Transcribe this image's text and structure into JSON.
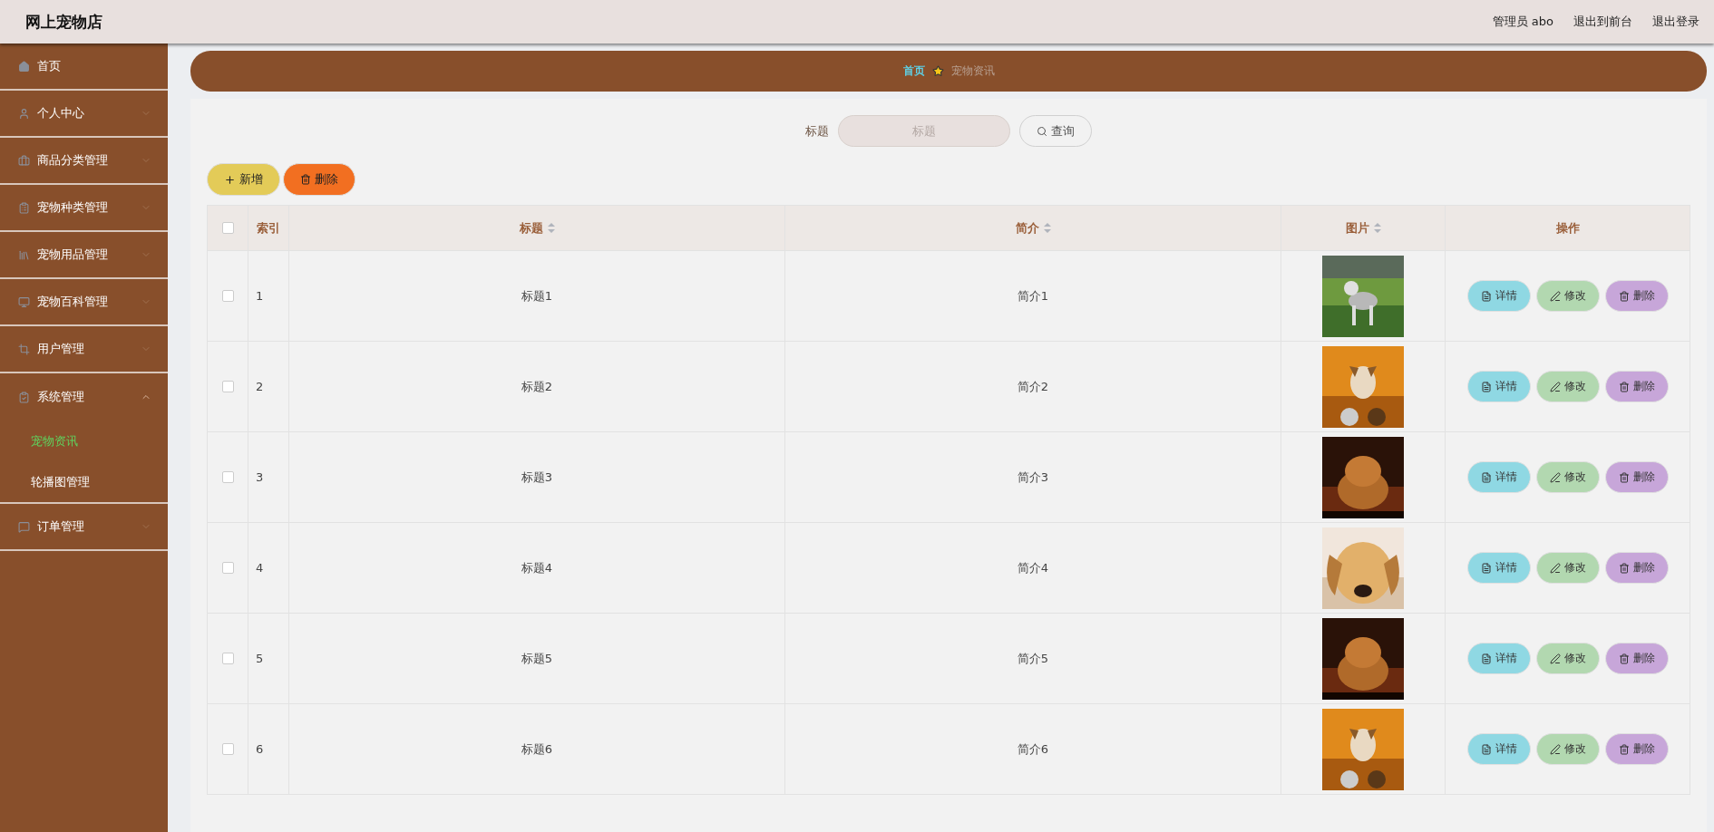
{
  "header": {
    "title": "网上宠物店",
    "links": [
      "管理员 abo",
      "退出到前台",
      "退出登录"
    ]
  },
  "sidebar": {
    "items": [
      {
        "label": "首页",
        "kind": "link"
      },
      {
        "label": "个人中心",
        "kind": "group",
        "expanded": false
      },
      {
        "label": "商品分类管理",
        "kind": "group",
        "expanded": false
      },
      {
        "label": "宠物种类管理",
        "kind": "group",
        "expanded": false
      },
      {
        "label": "宠物用品管理",
        "kind": "group",
        "expanded": false
      },
      {
        "label": "宠物百科管理",
        "kind": "group",
        "expanded": false
      },
      {
        "label": "用户管理",
        "kind": "group",
        "expanded": false
      },
      {
        "label": "系统管理",
        "kind": "group",
        "expanded": true,
        "children": [
          {
            "label": "宠物资讯",
            "selected": true
          },
          {
            "label": "轮播图管理",
            "selected": false
          }
        ]
      },
      {
        "label": "订单管理",
        "kind": "group",
        "expanded": false
      }
    ]
  },
  "breadcrumb": [
    {
      "label": "首页",
      "current": false
    },
    {
      "label": "宠物资讯",
      "current": true
    }
  ],
  "search": {
    "label": "标题",
    "placeholder": "标题",
    "button": "查询"
  },
  "toolbar": [
    {
      "label": "新增",
      "kind": "add"
    },
    {
      "label": "删除",
      "kind": "delete"
    }
  ],
  "table": {
    "select_all": {
      "checked": false
    },
    "columns": [
      {
        "label": "索引",
        "sortable": false
      },
      {
        "label": "标题",
        "sortable": true
      },
      {
        "label": "简介",
        "sortable": true
      },
      {
        "label": "图片",
        "sortable": true
      },
      {
        "label": "操作",
        "sortable": false
      }
    ],
    "rows": [
      {
        "checked": false,
        "index": "1",
        "title": "标题1",
        "intro": "简介1",
        "actions": [
          {
            "label": "详情",
            "kind": "detail"
          },
          {
            "label": "修改",
            "kind": "edit"
          },
          {
            "label": "删除",
            "kind": "delete"
          }
        ]
      },
      {
        "checked": false,
        "index": "2",
        "title": "标题2",
        "intro": "简介2",
        "actions": [
          {
            "label": "详情",
            "kind": "detail"
          },
          {
            "label": "修改",
            "kind": "edit"
          },
          {
            "label": "删除",
            "kind": "delete"
          }
        ]
      },
      {
        "checked": false,
        "index": "3",
        "title": "标题3",
        "intro": "简介3",
        "actions": [
          {
            "label": "详情",
            "kind": "detail"
          },
          {
            "label": "修改",
            "kind": "edit"
          },
          {
            "label": "删除",
            "kind": "delete"
          }
        ]
      },
      {
        "checked": false,
        "index": "4",
        "title": "标题4",
        "intro": "简介4",
        "actions": [
          {
            "label": "详情",
            "kind": "detail"
          },
          {
            "label": "修改",
            "kind": "edit"
          },
          {
            "label": "删除",
            "kind": "delete"
          }
        ]
      },
      {
        "checked": false,
        "index": "5",
        "title": "标题5",
        "intro": "简介5",
        "actions": [
          {
            "label": "详情",
            "kind": "detail"
          },
          {
            "label": "修改",
            "kind": "edit"
          },
          {
            "label": "删除",
            "kind": "delete"
          }
        ]
      },
      {
        "checked": false,
        "index": "6",
        "title": "标题6",
        "intro": "简介6",
        "actions": [
          {
            "label": "详情",
            "kind": "detail"
          },
          {
            "label": "修改",
            "kind": "edit"
          },
          {
            "label": "删除",
            "kind": "delete"
          }
        ]
      }
    ]
  }
}
